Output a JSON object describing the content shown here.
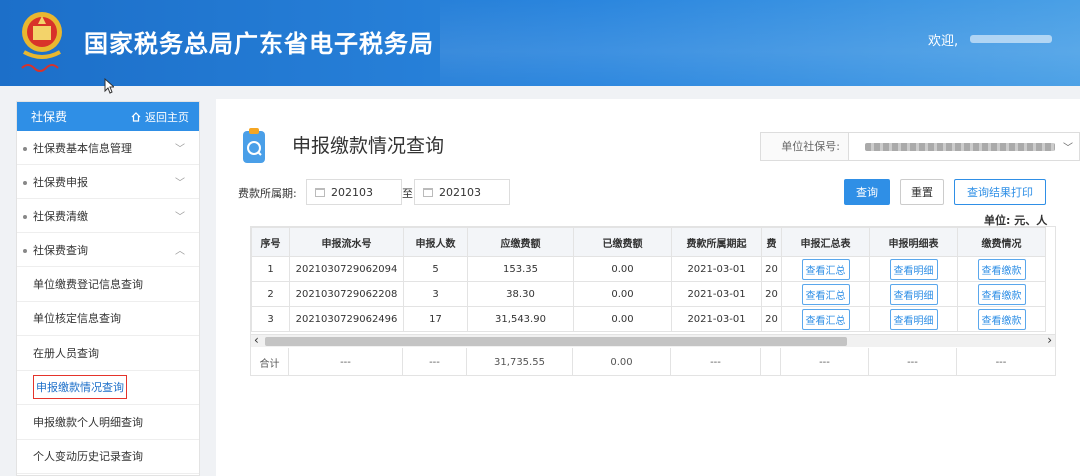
{
  "header": {
    "title": "国家税务总局广东省电子税务局",
    "welcome": "欢迎,"
  },
  "sidebar": {
    "title": "社保费",
    "home_link": "返回主页",
    "menu": [
      {
        "label": "社保费基本信息管理",
        "chev": "﹀"
      },
      {
        "label": "社保费申报",
        "chev": "﹀"
      },
      {
        "label": "社保费清缴",
        "chev": "﹀"
      },
      {
        "label": "社保费查询",
        "chev": "︿"
      }
    ],
    "sub_items": [
      {
        "label": "单位缴费登记信息查询"
      },
      {
        "label": "单位核定信息查询"
      },
      {
        "label": "在册人员查询"
      },
      {
        "label": "申报缴款情况查询"
      },
      {
        "label": "申报缴款个人明细查询"
      },
      {
        "label": "个人变动历史记录查询"
      }
    ]
  },
  "main": {
    "page_title": "申报缴款情况查询",
    "unit_label": "单位社保号:",
    "period_label": "费款所属期:",
    "date_from": "202103",
    "to_label": "至",
    "date_to": "202103",
    "query_button": "查询",
    "reset_button": "重置",
    "print_button": "查询结果打印",
    "unit_note": "单位: 元、人"
  },
  "table": {
    "headers": [
      "序号",
      "申报流水号",
      "申报人数",
      "应缴费额",
      "已缴费额",
      "费款所属期起",
      "费",
      "申报汇总表",
      "申报明细表",
      "缴费情况"
    ],
    "rows": [
      {
        "no": "1",
        "serial": "2021030729062094",
        "count": "5",
        "due": "153.35",
        "paid": "0.00",
        "period_start": "2021-03-01",
        "trunc": "20",
        "summary": "查看汇总",
        "detail": "查看明细",
        "payment": "查看缴款"
      },
      {
        "no": "2",
        "serial": "2021030729062208",
        "count": "3",
        "due": "38.30",
        "paid": "0.00",
        "period_start": "2021-03-01",
        "trunc": "20",
        "summary": "查看汇总",
        "detail": "查看明细",
        "payment": "查看缴款"
      },
      {
        "no": "3",
        "serial": "2021030729062496",
        "count": "17",
        "due": "31,543.90",
        "paid": "0.00",
        "period_start": "2021-03-01",
        "trunc": "20",
        "summary": "查看汇总",
        "detail": "查看明细",
        "payment": "查看缴款"
      }
    ],
    "total": {
      "label": "合计",
      "serial": "---",
      "count": "---",
      "due": "31,735.55",
      "paid": "0.00",
      "period_start": "---",
      "summary": "---",
      "detail": "---",
      "payment": "---"
    }
  },
  "colors": {
    "primary": "#2f8fe6",
    "header_bg": "#1c6fc9",
    "active_border": "#e5332a"
  }
}
